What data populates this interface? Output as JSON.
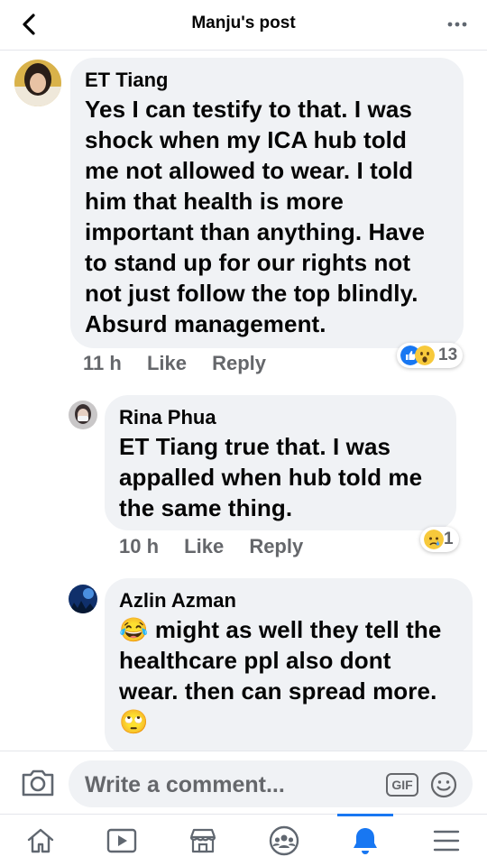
{
  "header": {
    "title": "Manju's post"
  },
  "comments": [
    {
      "author": "ET Tiang",
      "text": "Yes I can testify to that. I was shock when my ICA hub told me not allowed to wear. I told him that health is more important than anything. Have to stand up for our rights not not just follow the top blindly. Absurd management.",
      "time": "11 h",
      "like": "Like",
      "reply": "Reply",
      "reactions": [
        "like-icon",
        "wow-icon"
      ],
      "reaction_count": "13"
    },
    {
      "author": "Rina Phua",
      "text": "ET Tiang true that. I was appalled when hub told me the same thing.",
      "time": "10 h",
      "like": "Like",
      "reply": "Reply",
      "reactions": [
        "sad-icon"
      ],
      "reaction_count": "1"
    },
    {
      "author": "Azlin Azman",
      "text_lead_emoji": "😂",
      "text": "might as well they tell the healthcare ppl also dont wear. then can spread more.",
      "text_trail_emoji": "🙄"
    }
  ],
  "composer": {
    "placeholder": "Write a comment...",
    "gif_label": "GIF"
  },
  "nav": {
    "active": "notifications",
    "items": [
      "home-icon",
      "watch-icon",
      "marketplace-icon",
      "groups-icon",
      "notifications-icon",
      "menu-icon"
    ]
  },
  "colors": {
    "accent": "#1877f2",
    "bubble": "#f0f2f5",
    "meta": "#65676b"
  }
}
